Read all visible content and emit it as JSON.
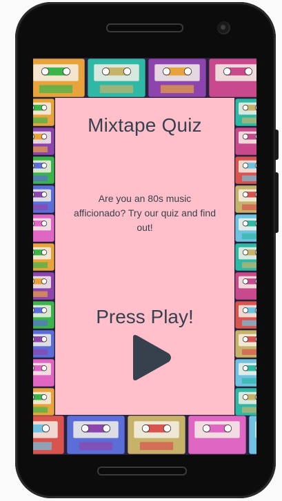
{
  "quiz": {
    "title": "Mixtape Quiz",
    "intro": "Are you an 80s music afficionado? Try our quiz and find out!",
    "start_prompt": "Press Play!",
    "start_icon": "play-icon"
  },
  "colors": {
    "card_background": "#ffc0cb",
    "text": "#37414d",
    "play_icon": "#37414d",
    "cassette_palette": [
      "#e8a33c",
      "#2fb8a6",
      "#8e44ad",
      "#c84a8c",
      "#3bb54a",
      "#d9534f",
      "#5b6ed8",
      "#c7b26a",
      "#e066c4",
      "#6fc3e0"
    ]
  },
  "background_pattern": "cassette-tapes"
}
